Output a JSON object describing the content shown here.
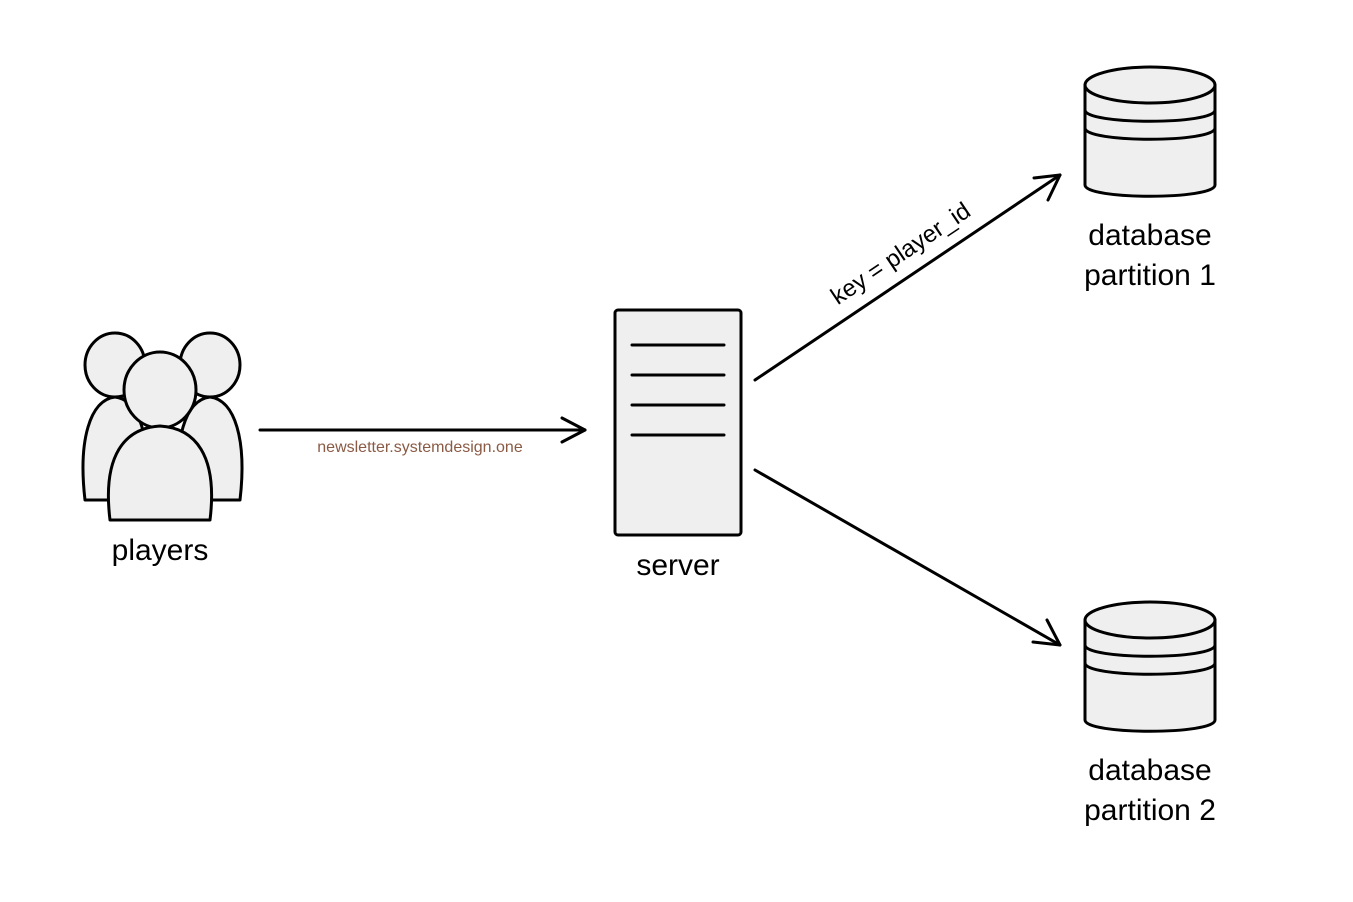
{
  "diagram": {
    "nodes": {
      "players": {
        "label": "players"
      },
      "server": {
        "label": "server"
      },
      "db1": {
        "label_line1": "database",
        "label_line2": "partition 1"
      },
      "db2": {
        "label_line1": "database",
        "label_line2": "partition 2"
      }
    },
    "edges": {
      "players_to_server": {},
      "server_to_db1": {
        "label": "key = player_id"
      },
      "server_to_db2": {}
    },
    "watermark": "newsletter.systemdesign.one"
  }
}
